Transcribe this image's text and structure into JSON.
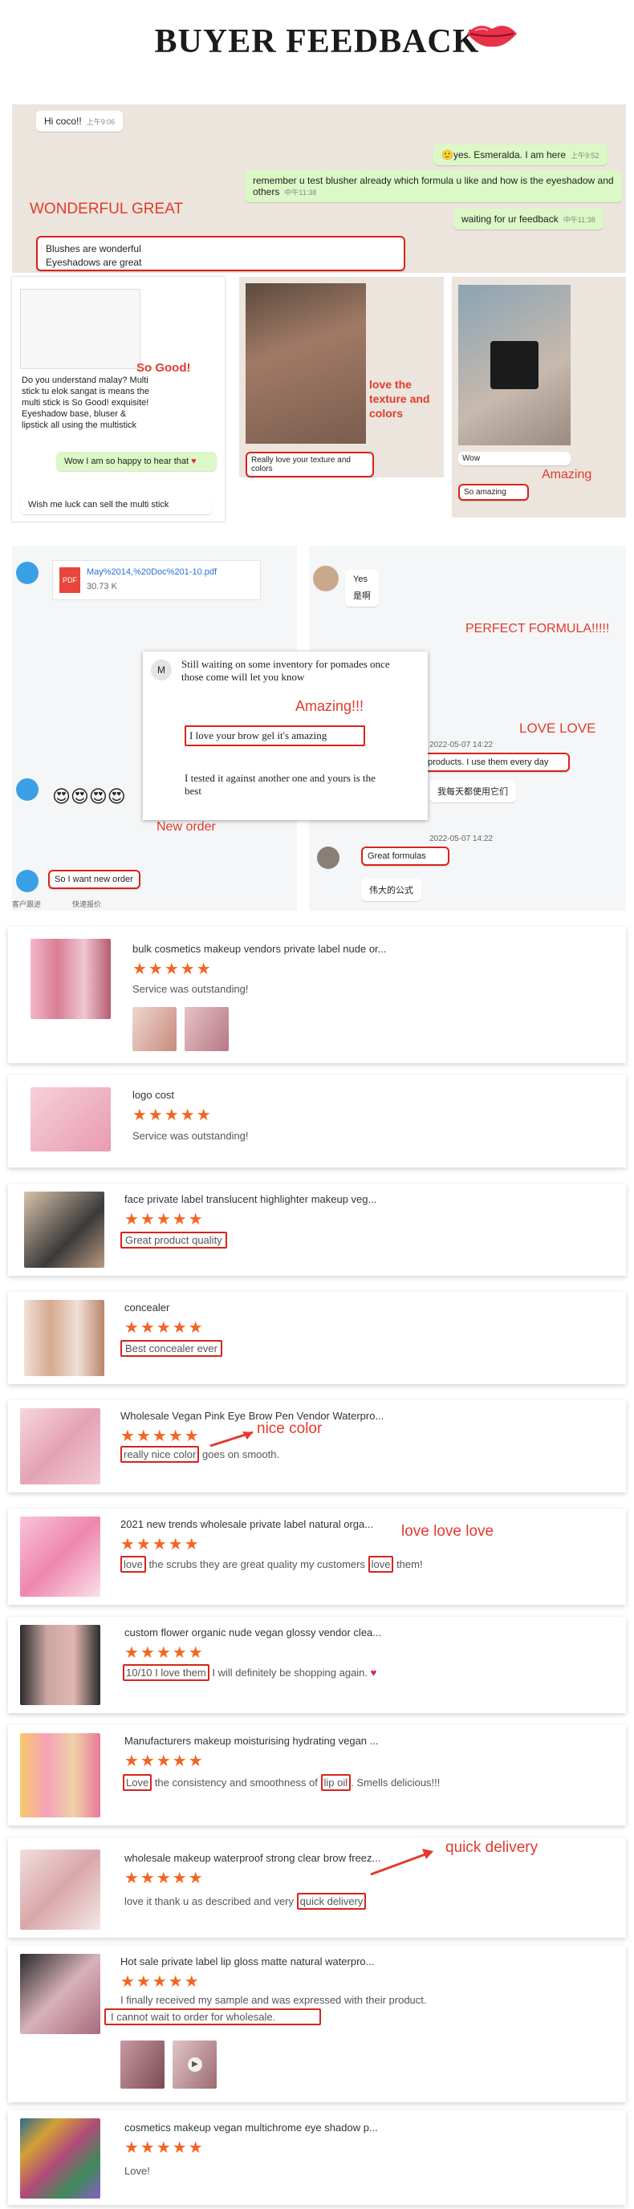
{
  "header": {
    "title": "BUYER FEEDBACK"
  },
  "chat1": {
    "msg_hi": "Hi coco!!",
    "msg_hi_time": "上午9:06",
    "msg_yes": "yes. Esmeralda. I am here",
    "msg_yes_time": "上午9:52",
    "msg_remember": "remember u test blusher  already  which formula u like  and how is the eyeshadow and others",
    "msg_remember_time": "中午11:38",
    "msg_waiting": "waiting for ur feedback",
    "msg_waiting_time": "中午11:38",
    "label_wonderful": "WONDERFUL   GREAT",
    "reply_line1": "Blushes are wonderful",
    "reply_line2": "Eyeshadows are great"
  },
  "chat2": {
    "label_so_good": "So Good!",
    "text_question": "Do you understand malay? Multi stick tu elok sangat is means the multi stick is So Good! exquisite! Eyeshadow base, bluser & lipstick all using the multistick",
    "text_happy": "Wow I am so happy to hear that",
    "text_sell": "Wish me luck can sell the multi stick",
    "label_love_texture": "love the texture and colors",
    "text_love_texture": "Really love your texture and colors",
    "text_wow": "Wow",
    "label_amazing": "Amazing",
    "text_so_amazing": "So amazing"
  },
  "chat3": {
    "file_name": "May%2014,%20Doc%201-10.pdf",
    "file_size": "30.73 K",
    "msg_still": "Still waiting on some inventory for pomades once those come will let you know",
    "msg_brow": "I love your brow gel it's amazing",
    "msg_tested": "I tested it against another one and yours is the best",
    "label_amazing": "Amazing!!!",
    "label_new_order": "New order",
    "text_new_order": "So I want new order",
    "footer_left": "客户跟进",
    "footer_right": "快速报价"
  },
  "chat4": {
    "yes": "Yes",
    "yes_cn": "是啊",
    "label_perfect": "PERFECT FORMULA!!!!!",
    "label_love": "LOVE LOVE",
    "ts1": "2022-05-07 14:22",
    "msg_products": "products. I use them every day",
    "msg_products_cn": "我每天都使用它们",
    "ts2": "2022-05-07 14:22",
    "msg_great": "Great formulas",
    "msg_great_cn": "伟大的公式"
  },
  "reviews": [
    {
      "product": "bulk cosmetics makeup vendors private label nude or...",
      "text": "Service was outstanding!"
    },
    {
      "product": "logo cost",
      "text": "Service was outstanding!"
    },
    {
      "product": "face private label translucent highlighter makeup veg...",
      "text": "Great product quality"
    },
    {
      "product": "concealer",
      "text": "Best concealer ever"
    },
    {
      "product": "Wholesale Vegan Pink Eye Brow Pen Vendor Waterpro...",
      "text_a": "really nice color",
      "text_b": " goes on smooth.",
      "label": "nice color"
    },
    {
      "product": "2021 new trends wholesale private label natural orga...",
      "text_a": "love",
      "text_b": " the scrubs they are great quality my customers ",
      "text_c": "love",
      "text_d": " them!",
      "label": "love love love"
    },
    {
      "product": "custom flower organic nude vegan glossy vendor clea...",
      "text_a": "10/10 I love them",
      "text_b": " I will definitely be shopping again."
    },
    {
      "product": "Manufacturers makeup moisturising hydrating vegan ...",
      "text_a": "Love",
      "text_b": " the consistency and smoothness of ",
      "text_c": "lip oil",
      "text_d": ". Smells delicious!!!"
    },
    {
      "product": "wholesale makeup waterproof strong clear brow freez...",
      "text_a": "love it thank u as described and very ",
      "text_b": "quick delivery",
      "label": "quick delivery"
    },
    {
      "product": "Hot sale private label lip gloss matte natural waterpro...",
      "text_a": "I finally received my sample and was expressed with their product.",
      "text_b": "I cannot wait to order for wholesale."
    },
    {
      "product": "cosmetics makeup vegan multichrome eye shadow p...",
      "text": "Love!"
    }
  ],
  "stars": "★★★★★",
  "colors": {
    "accent_red": "#d9231b",
    "star_orange": "#f26522",
    "chat_green": "#dcf8c6",
    "chat_bg": "#ece5dd"
  }
}
